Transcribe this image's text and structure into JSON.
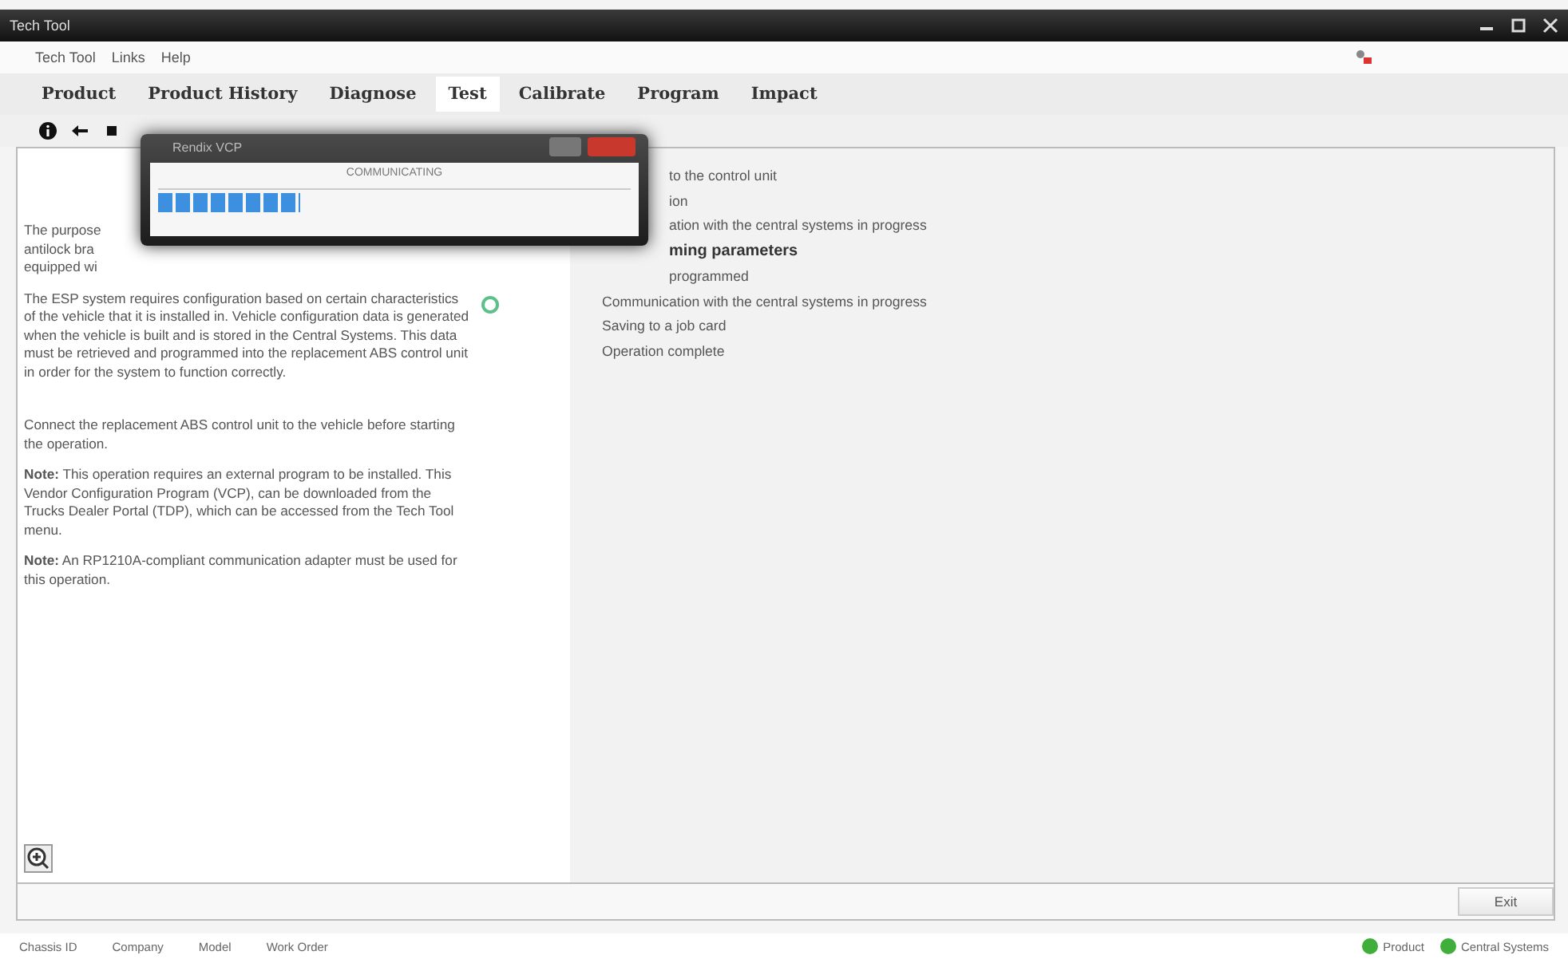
{
  "window": {
    "title": "Tech Tool"
  },
  "menu": [
    "Tech Tool",
    "Links",
    "Help"
  ],
  "tabs": [
    {
      "label": "Product",
      "selected": false
    },
    {
      "label": "Product History",
      "selected": false
    },
    {
      "label": "Diagnose",
      "selected": false
    },
    {
      "label": "Test",
      "selected": true
    },
    {
      "label": "Calibrate",
      "selected": false
    },
    {
      "label": "Program",
      "selected": false
    },
    {
      "label": "Impact",
      "selected": false
    }
  ],
  "intro_lines": [
    "The purpose",
    "antilock bra",
    "equipped wi"
  ],
  "paragraphs": [
    {
      "text": "The ESP system requires configuration based on certain characteristics of the vehicle that it is installed in. Vehicle configuration data is generated when the vehicle is built and is stored in the Central Systems. This data must be retrieved and programmed into the replacement ABS control unit in order for the system to function correctly."
    },
    {
      "text": "Connect the replacement ABS control unit to the vehicle before starting the operation."
    },
    {
      "text": "**Note:** This operation requires an external program to be installed. This Vendor Configuration Program (VCP), can be downloaded from the Trucks Dealer Portal (TDP), which can be accessed from the Tech Tool menu."
    },
    {
      "text": "**Note:** An RP1210A-compliant communication adapter must be used for this operation."
    }
  ],
  "steps": [
    {
      "text": "to the control unit",
      "kind": "partial",
      "bold": false
    },
    {
      "text": "ion",
      "kind": "partial",
      "bold": false
    },
    {
      "text": "ation with the central systems in progress",
      "kind": "partial",
      "bold": false
    },
    {
      "text": "ming parameters",
      "kind": "partial",
      "bold": true
    },
    {
      "text": "programmed",
      "kind": "partial",
      "bold": false
    },
    {
      "text": "Communication with the central systems in progress",
      "kind": "full",
      "bold": false
    },
    {
      "text": "Saving to a job card",
      "kind": "full",
      "bold": false
    },
    {
      "text": "Operation complete",
      "kind": "full",
      "bold": false
    }
  ],
  "dialog": {
    "title": "Rendix VCP",
    "status": "COMMUNICATING",
    "level": 0.3
  },
  "exit_button": "Exit",
  "status_bar": {
    "fields": [
      "Chassis ID",
      "Company",
      "Model",
      "Work Order"
    ],
    "indicators": [
      {
        "label": "Product",
        "color": "#3fae3a"
      },
      {
        "label": "Central Systems",
        "color": "#3fae3a"
      }
    ]
  }
}
